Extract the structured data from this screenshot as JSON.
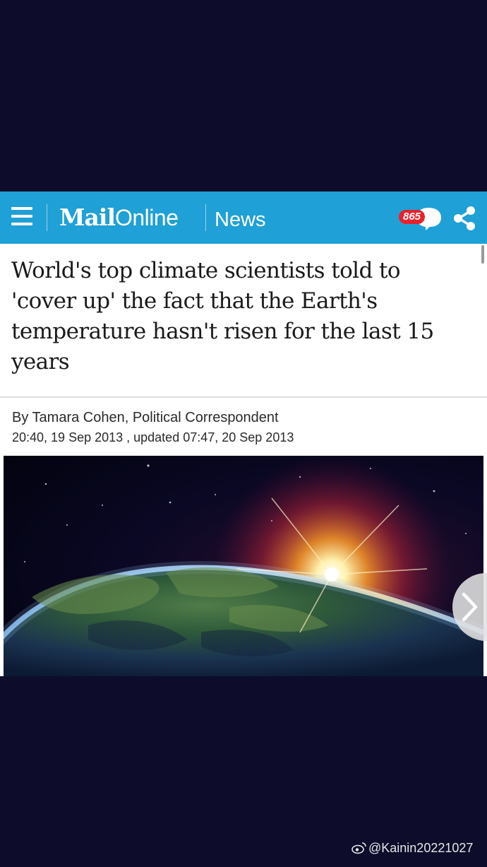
{
  "header": {
    "logo_text_mail": "Mail",
    "logo_text_online": "Online",
    "section": "News",
    "comment_count": "865",
    "brand_color": "#1fa0d6",
    "badge_color": "#e8212b"
  },
  "article": {
    "headline": "World's top climate scientists told to 'cover up' the fact that the Earth's temperature hasn't risen for the last 15 years",
    "byline": "By Tamara Cohen, Political Correspondent",
    "dateline": "20:40, 19 Sep 2013 , updated 07:47, 20 Sep 2013"
  },
  "icons": {
    "menu": "hamburger-menu-icon",
    "comments": "speech-bubble-icon",
    "share": "share-icon",
    "next": "chevron-right-icon"
  },
  "watermark": {
    "text": "@Kainin20221027"
  }
}
